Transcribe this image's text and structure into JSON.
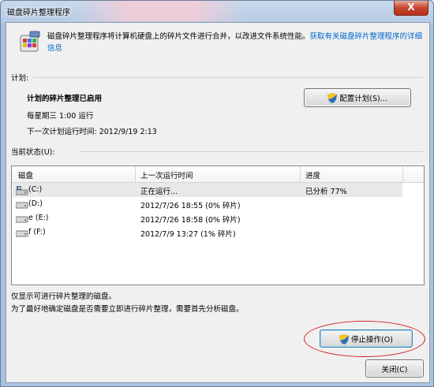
{
  "window": {
    "title": "磁盘碎片整理程序"
  },
  "intro": {
    "text": "磁盘碎片整理程序将计算机硬盘上的碎片文件进行合并，以改进文件系统性能。",
    "link": "获取有关磁盘碎片整理程序的详细信息"
  },
  "schedule": {
    "section_label": "计划:",
    "title": "计划的碎片整理已启用",
    "run_time": "每星期三  1:00 运行",
    "next_run": "下一次计划运行时间: 2012/9/19 2:13",
    "configure_button": "配置计划(S)..."
  },
  "status": {
    "section_label": "当前状态(U):",
    "columns": [
      "磁盘",
      "上一次运行时间",
      "进度"
    ],
    "rows": [
      {
        "disk": "(C:)",
        "last_run": "正在运行...",
        "progress": "已分析 77%",
        "icon": "system-drive-icon"
      },
      {
        "disk": "(D:)",
        "last_run": "2012/7/26 18:55 (0% 碎片)",
        "progress": "",
        "icon": "hard-drive-icon"
      },
      {
        "disk": "e (E:)",
        "last_run": "2012/7/26 18:58 (0% 碎片)",
        "progress": "",
        "icon": "hard-drive-icon"
      },
      {
        "disk": "f (F:)",
        "last_run": "2012/7/9 13:27 (1% 碎片)",
        "progress": "",
        "icon": "hard-drive-icon"
      }
    ]
  },
  "notes": {
    "line1": "仅显示可进行碎片整理的磁盘。",
    "line2": "为了最好地确定磁盘是否需要立即进行碎片整理，需要首先分析磁盘。"
  },
  "buttons": {
    "stop": "停止操作(O)",
    "close": "关闭(C)",
    "window_close": "X"
  },
  "colors": {
    "link": "#0066cc",
    "highlight_ring": "#d42020",
    "selected_row": "#e8e8e8"
  }
}
